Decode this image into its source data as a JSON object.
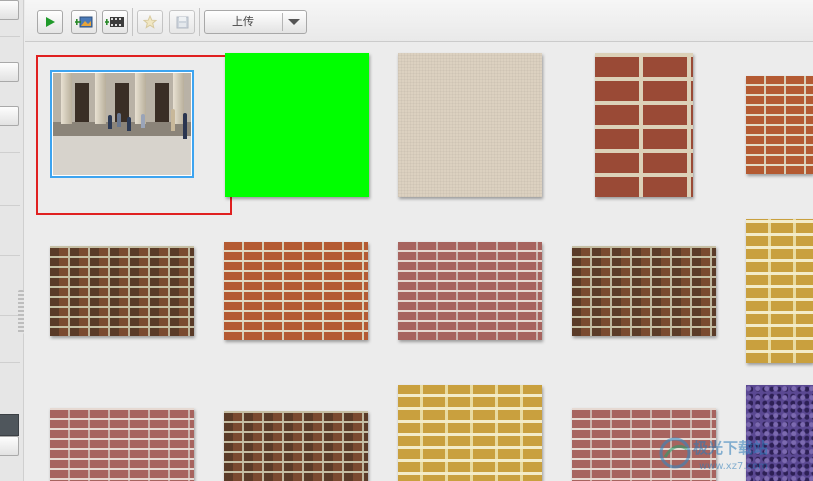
{
  "toolbar": {
    "play_icon": "play-icon",
    "add_image_icon": "add-image-icon",
    "add_video_icon": "add-video-icon",
    "favorite_icon": "star-icon",
    "save_icon": "save-icon",
    "upload_label": "上传",
    "upload_dropdown_icon": "chevron-down-icon"
  },
  "library": {
    "items": [
      {
        "name": "street-photo",
        "kind": "photo",
        "selected": true
      },
      {
        "name": "green-screen",
        "kind": "color",
        "color": "#00ff00"
      },
      {
        "name": "linen-texture",
        "kind": "texture"
      },
      {
        "name": "brick-wall-large",
        "kind": "texture"
      },
      {
        "name": "brick-wall-red",
        "kind": "texture"
      },
      {
        "name": "brick-wall-dark",
        "kind": "texture"
      },
      {
        "name": "brick-wall-orange",
        "kind": "texture"
      },
      {
        "name": "brick-wall-pink",
        "kind": "texture"
      },
      {
        "name": "brick-wall-dark-2",
        "kind": "texture"
      },
      {
        "name": "brick-wall-yellow",
        "kind": "texture"
      },
      {
        "name": "brick-wall-pink-2",
        "kind": "texture"
      },
      {
        "name": "brick-wall-dark-3",
        "kind": "texture"
      },
      {
        "name": "brick-wall-yellow-2",
        "kind": "texture"
      },
      {
        "name": "brick-wall-pink-3",
        "kind": "texture"
      },
      {
        "name": "purple-glitter",
        "kind": "texture"
      }
    ]
  },
  "highlight_color": "#e02020",
  "selection_color": "#3da4f0",
  "watermark": {
    "text": "极光下载站",
    "subtext": "www.xz7.com"
  }
}
